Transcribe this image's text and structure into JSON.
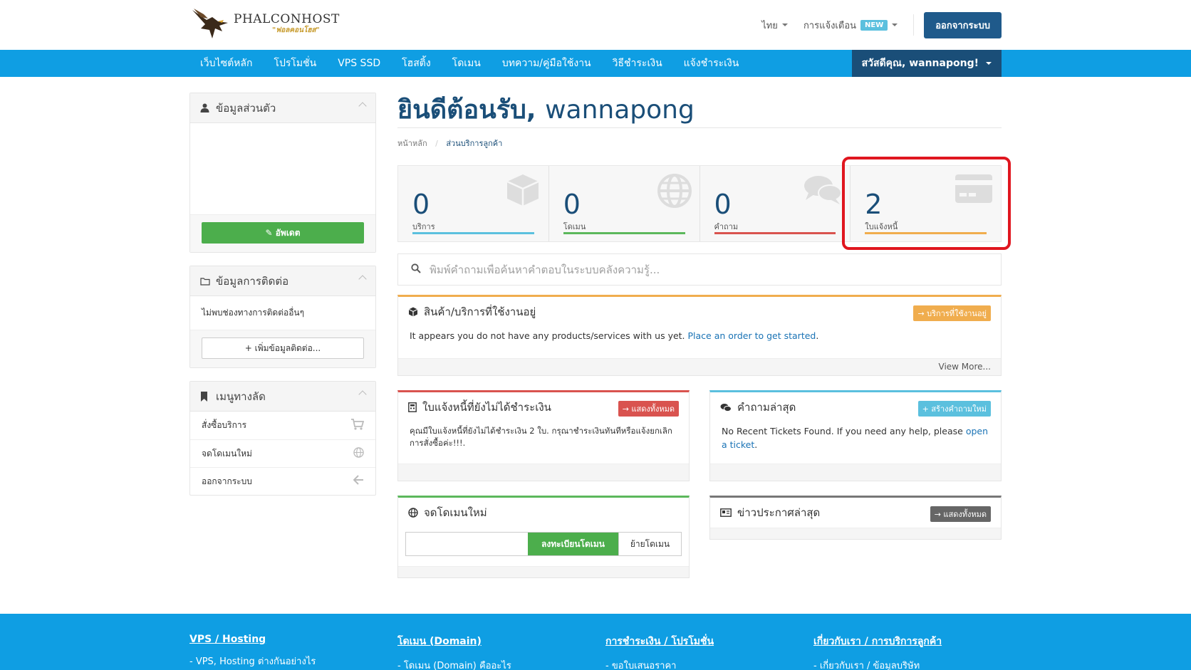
{
  "header": {
    "logo_name": "PHALCONHOST",
    "logo_tagline": "\"ฟอลคอนโฮส\"",
    "lang_label": "ไทย",
    "notif_label": "การแจ้งเตือน",
    "notif_badge": "NEW",
    "logout_label": "ออกจากระบบ"
  },
  "nav": {
    "items": [
      "เว็บไซต์หลัก",
      "โปรโมชั่น",
      "VPS SSD",
      "โฮสติ้ง",
      "โดเมน",
      "บทความ/คู่มือใช้งาน",
      "วิธีชำระเงิน",
      "แจ้งชำระเงิน"
    ],
    "user_label": "สวัสดีคุณ, wannapong!"
  },
  "sidebar": {
    "profile_title": "ข้อมูลส่วนตัว",
    "update_label": "อัพเดต",
    "contact_title": "ข้อมูลการติดต่อ",
    "contact_empty": "ไม่พบช่องทางการติดต่ออื่นๆ",
    "add_contact_label": "เพิ่มข้อมูลติดต่อ...",
    "shortcuts_title": "เมนูทางลัด",
    "shortcuts": [
      "สั่งซื้อบริการ",
      "จดโดเมนใหม่",
      "ออกจากระบบ"
    ]
  },
  "main": {
    "welcome_prefix": "ยินดีต้อนรับ,",
    "welcome_name": "wannapong",
    "breadcrumb_home": "หน้าหลัก",
    "breadcrumb_current": "ส่วนบริการลูกค้า",
    "tiles": [
      {
        "value": "0",
        "label": "บริการ",
        "color": "#5bc0de"
      },
      {
        "value": "0",
        "label": "โดเมน",
        "color": "#5cb85c"
      },
      {
        "value": "0",
        "label": "คำถาม",
        "color": "#d9534f"
      },
      {
        "value": "2",
        "label": "ใบแจ้งหนี้",
        "color": "#f0ad4e"
      }
    ],
    "search_placeholder": "พิมพ์คำถามเพื่อค้นหาคำตอบในระบบคลังความรู้...",
    "products": {
      "title": "สินค้า/บริการที่ใช้งานอยู่",
      "button": "บริการที่ใช้งานอยู่",
      "text": "It appears you do not have any products/services with us yet.",
      "link": "Place an order to get started",
      "link_suffix": ".",
      "footer": "View More..."
    },
    "invoices": {
      "title": "ใบแจ้งหนี้ที่ยังไม่ได้ชำระเงิน",
      "button": "แสดงทั้งหมด",
      "text": "คุณมีใบแจ้งหนี้ที่ยังไม่ได้ชำระเงิน 2 ใบ. กรุณาชำระเงินทันทีหรือแจ้งยกเลิกการสั่งซื้อค่ะ!!!."
    },
    "tickets": {
      "title": "คำถามล่าสุด",
      "button": "สร้างคำถามใหม่",
      "text": "No Recent Tickets Found. If you need any help, please",
      "link": "open a ticket",
      "link_suffix": "."
    },
    "domain": {
      "title": "จดโดเมนใหม่",
      "register": "ลงทะเบียนโดเมน",
      "transfer": "ย้ายโดเมน"
    },
    "news": {
      "title": "ข่าวประกาศล่าสุด",
      "button": "แสดงทั้งหมด"
    }
  },
  "footer": {
    "cols": [
      {
        "title": "VPS / Hosting",
        "item": "- VPS, Hosting ต่างกันอย่างไร"
      },
      {
        "title": "โดเมน (Domain)",
        "item": "- โดเมน (Domain) คืออะไร"
      },
      {
        "title": "การชำระเงิน / โปรโมชั่น",
        "item": "- ขอใบเสนอราคา"
      },
      {
        "title": "เกี่ยวกับเรา / การบริการลูกค้า",
        "item": "- เกี่ยวกับเรา / ข้อมูลบริษัท"
      }
    ]
  }
}
